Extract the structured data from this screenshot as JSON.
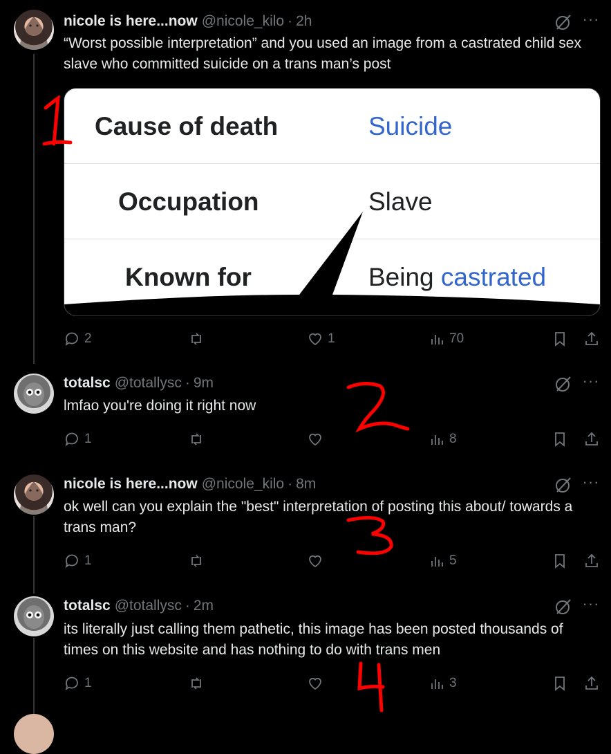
{
  "tweets": [
    {
      "name": "nicole is here...now",
      "handle": "@nicole_kilo",
      "time": "2h",
      "text": "“Worst possible interpretation” and you used an image from a castrated child sex slave who committed suicide on a trans man’s post",
      "replies": "2",
      "retweets": "",
      "likes": "1",
      "views": "70",
      "card": {
        "rows": [
          {
            "label": "Cause of death",
            "value": "Suicide",
            "value_is_link": true
          },
          {
            "label": "Occupation",
            "value": "Slave",
            "value_is_link": false
          },
          {
            "label": "Known for",
            "value_prefix": "Being",
            "value_link": "castrated"
          }
        ]
      },
      "annotation": "1"
    },
    {
      "name": "totalsc",
      "handle": "@totallysc",
      "time": "9m",
      "text": "lmfao you're doing it right now",
      "replies": "1",
      "likes": "",
      "views": "8",
      "annotation": "2"
    },
    {
      "name": "nicole is here...now",
      "handle": "@nicole_kilo",
      "time": "8m",
      "text": "ok well can you explain the \"best\" interpretation of posting this about/ towards a trans man?",
      "replies": "1",
      "likes": "",
      "views": "5",
      "annotation": "3"
    },
    {
      "name": "totalsc",
      "handle": "@totallysc",
      "time": "2m",
      "text": "its literally just calling them pathetic, this image has been posted thousands of times on this website and has nothing to do with trans men",
      "replies": "1",
      "likes": "",
      "views": "3",
      "annotation": "4"
    }
  ],
  "colors": {
    "background": "#000000",
    "text": "#e7e9ea",
    "muted": "#71767b",
    "link": "#3366cc",
    "annotation": "#ff0000"
  },
  "icons": [
    "grok-icon",
    "more-icon",
    "reply-icon",
    "retweet-icon",
    "like-icon",
    "views-icon",
    "bookmark-icon",
    "share-icon"
  ]
}
